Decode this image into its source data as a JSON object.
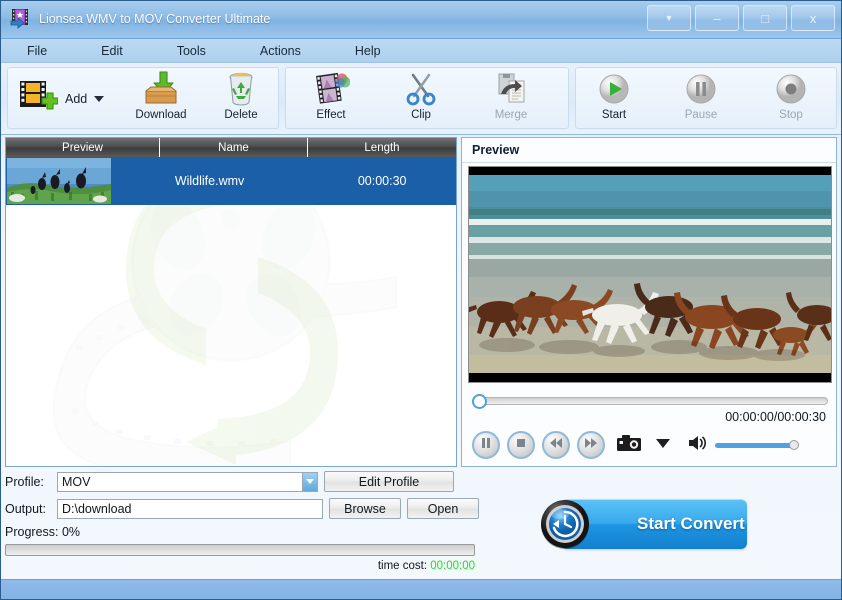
{
  "window": {
    "title": "Lionsea WMV to MOV Converter Ultimate",
    "icon": "app-film-star-icon",
    "controls": {
      "dropdown": "▼",
      "minimize": "–",
      "maximize": "□",
      "close": "x"
    }
  },
  "menubar": {
    "items": [
      {
        "label": "File"
      },
      {
        "label": "Edit"
      },
      {
        "label": "Tools"
      },
      {
        "label": "Actions"
      },
      {
        "label": "Help"
      }
    ]
  },
  "toolbar": {
    "groups": [
      {
        "name": "file-group",
        "buttons": [
          {
            "label": "Add",
            "icon": "add-film-icon",
            "has_caret": true,
            "enabled": true
          },
          {
            "label": "Download",
            "icon": "download-box-icon",
            "enabled": true
          },
          {
            "label": "Delete",
            "icon": "recycle-bin-icon",
            "enabled": true
          }
        ]
      },
      {
        "name": "edit-group",
        "buttons": [
          {
            "label": "Effect",
            "icon": "effect-filmstrip-icon",
            "enabled": true
          },
          {
            "label": "Clip",
            "icon": "scissors-icon",
            "enabled": true
          },
          {
            "label": "Merge",
            "icon": "merge-document-icon",
            "enabled": false
          }
        ]
      },
      {
        "name": "transport-group",
        "buttons": [
          {
            "label": "Start",
            "icon": "play-icon",
            "enabled": true
          },
          {
            "label": "Pause",
            "icon": "pause-icon",
            "enabled": false
          },
          {
            "label": "Stop",
            "icon": "stop-icon",
            "enabled": false
          }
        ]
      }
    ]
  },
  "filelist": {
    "columns": [
      "Preview",
      "Name",
      "Length"
    ],
    "rows": [
      {
        "thumbnail": "birds-on-grass-thumbnail",
        "name": "Wildlife.wmv",
        "length": "00:00:30",
        "selected": true
      }
    ],
    "watermark": "film-reel-convert-watermark"
  },
  "preview": {
    "title": "Preview",
    "video_frame": "horses-running-on-beach",
    "seek_position_percent": 0,
    "time_display": "00:00:00/00:00:30",
    "controls": [
      {
        "name": "pause-button",
        "icon": "pause-icon"
      },
      {
        "name": "stop-button",
        "icon": "stop-icon"
      },
      {
        "name": "rewind-button",
        "icon": "rewind-icon"
      },
      {
        "name": "forward-button",
        "icon": "fast-forward-icon"
      },
      {
        "name": "snapshot-button",
        "icon": "camera-icon"
      },
      {
        "name": "snapshot-menu-button",
        "icon": "chevron-down-icon"
      },
      {
        "name": "volume-button",
        "icon": "speaker-icon"
      }
    ],
    "volume_percent": 88
  },
  "settings": {
    "profile_label": "Profile:",
    "profile_value": "MOV",
    "profile_options": [
      "MOV"
    ],
    "edit_profile_label": "Edit Profile",
    "output_label": "Output:",
    "output_value": "D:\\download",
    "browse_label": "Browse",
    "open_label": "Open",
    "progress_label": "Progress: 0%",
    "progress_percent": 0,
    "time_cost_label": "time cost:",
    "time_cost_value": "00:00:00"
  },
  "convert": {
    "label": "Start Convert",
    "icon": "clock-convert-icon"
  },
  "colors": {
    "titlebar": "#8dbbe6",
    "accent_blue": "#1a5fa8",
    "convert_blue": "#1e95e0",
    "time_cost_green": "#19e519",
    "header_gray": "#4a4a4a"
  }
}
